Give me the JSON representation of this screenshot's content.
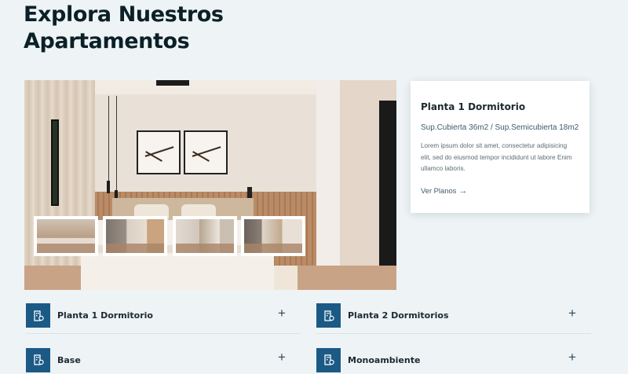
{
  "section": {
    "title": "Explora Nuestros Apartamentos"
  },
  "hero": {
    "thumbnails": [
      {
        "name": "thumb-bedroom"
      },
      {
        "name": "thumb-living"
      },
      {
        "name": "thumb-kitchen"
      },
      {
        "name": "thumb-dining"
      }
    ]
  },
  "card": {
    "title": "Planta 1 Dormitorio",
    "subtitle": "Sup.Cubierta 36m2 / Sup.Semicubierta 18m2",
    "description": "Lorem ipsum dolor sit amet, consectetur adipisicing elit, sed do eiusmod tempor incididunt ut labore Enim ullamco laboris.",
    "link_label": "Ver Planos",
    "link_icon": "arrow-right-icon"
  },
  "accordion": {
    "items": [
      {
        "label": "Planta 1 Dormitorio",
        "icon": "building-icon",
        "toggle": "+"
      },
      {
        "label": "Planta 2 Dormitorios",
        "icon": "building-icon",
        "toggle": "+"
      },
      {
        "label": "Base",
        "icon": "building-icon",
        "toggle": "+"
      },
      {
        "label": "Monoambiente",
        "icon": "building-icon",
        "toggle": "+"
      }
    ]
  },
  "colors": {
    "background": "#eef3f6",
    "accent": "#1b5a85",
    "title": "#0b2027",
    "link": "#3f5c6b"
  }
}
